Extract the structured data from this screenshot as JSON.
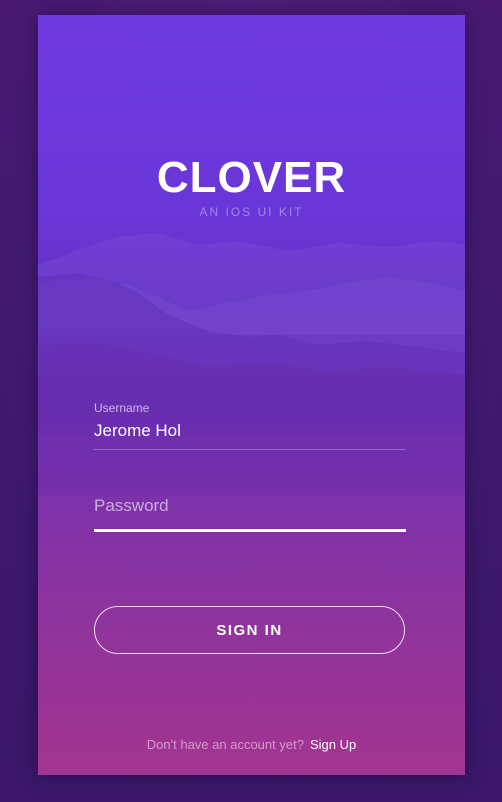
{
  "app": {
    "brand": "CLOVER",
    "tagline": "AN IOS UI KIT"
  },
  "form": {
    "username": {
      "label": "Username",
      "value": "Jerome Hol"
    },
    "password": {
      "placeholder": "Password",
      "value": ""
    },
    "submit_label": "SIGN IN"
  },
  "footer": {
    "prompt": "Don't have an account yet?",
    "link_label": "Sign Up"
  },
  "colors": {
    "gradient_top": "#6e3be0",
    "gradient_bottom": "#a3358f",
    "outer_background": "#3f1a6f",
    "text": "#ffffff"
  }
}
